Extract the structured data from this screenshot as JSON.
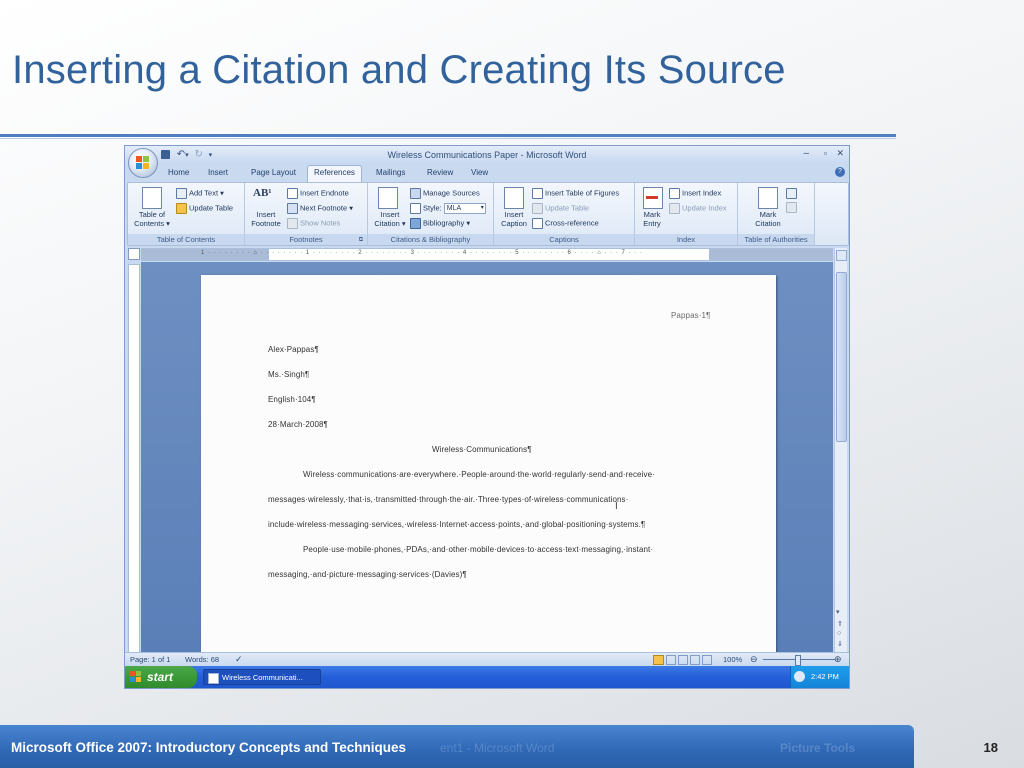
{
  "slide": {
    "title": "Inserting a Citation and Creating Its Source",
    "footer": "Microsoft Office 2007: Introductory Concepts and Techniques",
    "page_number": "18"
  },
  "window": {
    "title": "Wireless Communications Paper - Microsoft Word",
    "controls": [
      "–",
      "▫",
      "✕"
    ],
    "help": "?"
  },
  "tabs": [
    "Home",
    "Insert",
    "Page Layout",
    "References",
    "Mailings",
    "Review",
    "View"
  ],
  "active_tab": "References",
  "ribbon": {
    "toc": {
      "btn1": "Table of",
      "btn2": "Contents ▾",
      "add_text": "Add Text ▾",
      "update_table": "Update Table",
      "label": "Table of Contents"
    },
    "footnotes": {
      "insert1": "Insert",
      "insert2": "Footnote",
      "ab_icon": "AB¹",
      "insert_endnote": "Insert Endnote",
      "next_footnote": "Next Footnote ▾",
      "show_notes": "Show Notes",
      "label": "Footnotes"
    },
    "citations": {
      "insert1": "Insert",
      "insert2": "Citation ▾",
      "manage_sources": "Manage Sources",
      "style_label": "Style:",
      "style_value": "MLA",
      "bibliography": "Bibliography ▾",
      "label": "Citations & Bibliography"
    },
    "captions": {
      "insert1": "Insert",
      "insert2": "Caption",
      "insert_tof": "Insert Table of Figures",
      "update_table": "Update Table",
      "cross_ref": "Cross-reference",
      "label": "Captions"
    },
    "index": {
      "mark1": "Mark",
      "mark2": "Entry",
      "insert_index": "Insert Index",
      "update_index": "Update Index",
      "label": "Index"
    },
    "authorities": {
      "mark1": "Mark",
      "mark2": "Citation",
      "label": "Table of Authorities"
    }
  },
  "document": {
    "header": "Pappas·1¶",
    "lines": [
      "Alex·Pappas¶",
      "Ms.·Singh¶",
      "English·104¶",
      "28·March·2008¶"
    ],
    "heading": "Wireless·Communications¶",
    "para1": [
      "Wireless·communications·are·everywhere.·People·around·the·world·regularly·send·and·receive·",
      "messages·wirelessly,·that·is,·transmitted·through·the·air.·Three·types·of·wireless·communications·",
      "include·wireless·messaging·services,·wireless·Internet·access·points,·and·global·positioning·systems.¶"
    ],
    "para2": [
      "People·use·mobile·phones,·PDAs,·and·other·mobile·devices·to·access·text·messaging,·instant·",
      "messaging,·and·picture·messaging·services·(Davies)¶"
    ]
  },
  "status": {
    "page": "Page: 1 of 1",
    "words": "Words: 68",
    "zoom": "100%"
  },
  "taskbar": {
    "start": "start",
    "item": "Wireless Communicati...",
    "clock": "2:42 PM"
  },
  "footer_ghost": {
    "text1": "ent1 - Microsoft Word",
    "text2": "Picture Tools"
  }
}
